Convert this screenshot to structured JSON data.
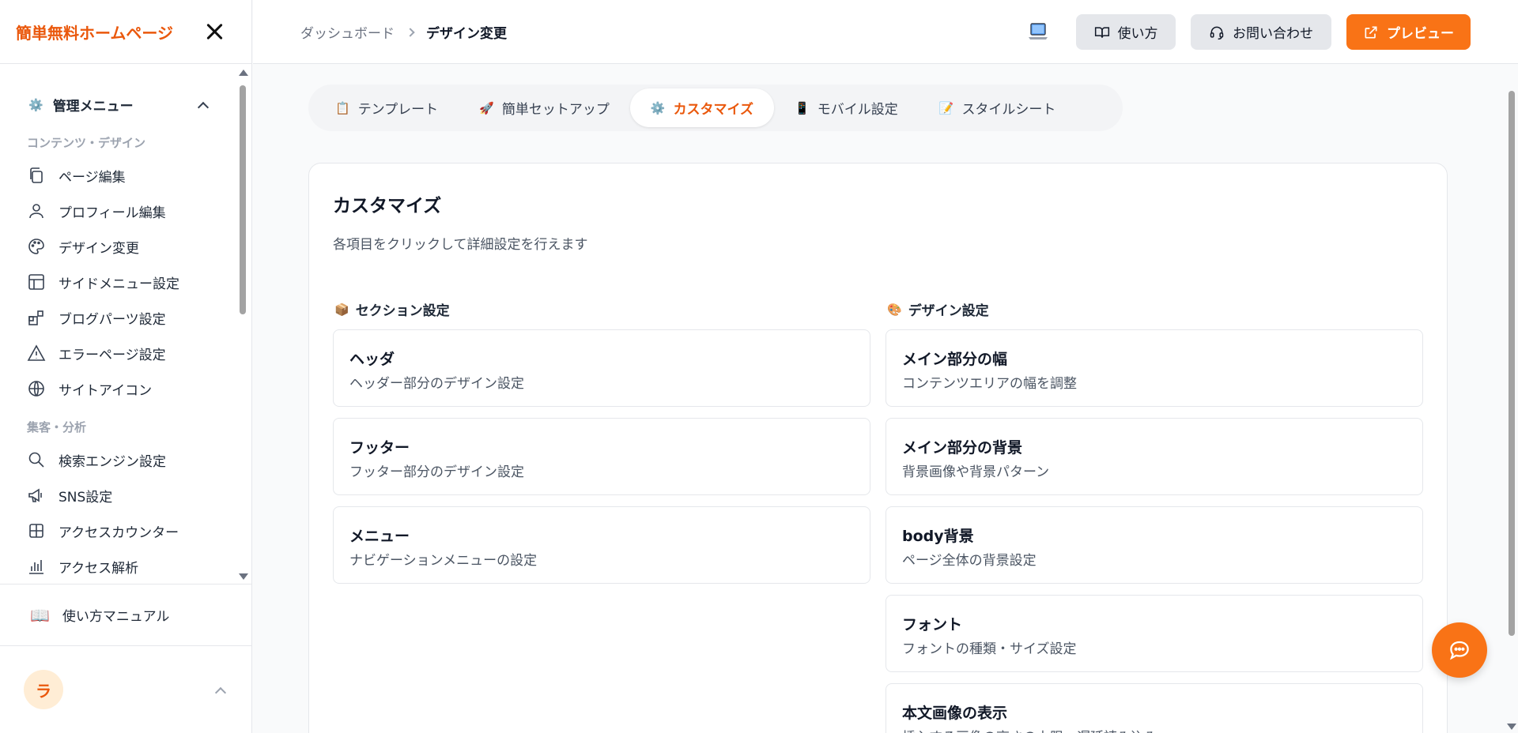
{
  "brand": {
    "title": "簡単無料ホームページ"
  },
  "sidebar": {
    "menu_title": "管理メニュー",
    "groups": [
      {
        "label": "コンテンツ・デザイン",
        "items": [
          {
            "label": "ページ編集",
            "icon": "copy-icon"
          },
          {
            "label": "プロフィール編集",
            "icon": "user-icon"
          },
          {
            "label": "デザイン変更",
            "icon": "palette-icon"
          },
          {
            "label": "サイドメニュー設定",
            "icon": "layout-icon"
          },
          {
            "label": "ブログパーツ設定",
            "icon": "blocks-icon"
          },
          {
            "label": "エラーページ設定",
            "icon": "warning-icon"
          },
          {
            "label": "サイトアイコン",
            "icon": "globe-icon"
          }
        ]
      },
      {
        "label": "集客・分析",
        "items": [
          {
            "label": "検索エンジン設定",
            "icon": "search-icon"
          },
          {
            "label": "SNS設定",
            "icon": "megaphone-icon"
          },
          {
            "label": "アクセスカウンター",
            "icon": "grid-icon"
          },
          {
            "label": "アクセス解析",
            "icon": "bar-chart-icon"
          }
        ]
      }
    ],
    "manual_label": "使い方マニュアル",
    "avatar_initial": "ラ"
  },
  "header": {
    "breadcrumb": [
      "ダッシュボード",
      "デザイン変更"
    ],
    "howto_label": "使い方",
    "contact_label": "お問い合わせ",
    "preview_label": "プレビュー"
  },
  "tabs": [
    {
      "label": "テンプレート",
      "emoji": "📋",
      "active": false
    },
    {
      "label": "簡単セットアップ",
      "emoji": "🚀",
      "active": false
    },
    {
      "label": "カスタマイズ",
      "emoji": "⚙️",
      "active": true
    },
    {
      "label": "モバイル設定",
      "emoji": "📱",
      "active": false
    },
    {
      "label": "スタイルシート",
      "emoji": "📝",
      "active": false
    }
  ],
  "main": {
    "title": "カスタマイズ",
    "description": "各項目をクリックして詳細設定を行えます",
    "section_settings": {
      "heading": "セクション設定",
      "emoji": "📦",
      "items": [
        {
          "title": "ヘッダ",
          "sub": "ヘッダー部分のデザイン設定"
        },
        {
          "title": "フッター",
          "sub": "フッター部分のデザイン設定"
        },
        {
          "title": "メニュー",
          "sub": "ナビゲーションメニューの設定"
        }
      ]
    },
    "design_settings": {
      "heading": "デザイン設定",
      "emoji": "🎨",
      "items": [
        {
          "title": "メイン部分の幅",
          "sub": "コンテンツエリアの幅を調整"
        },
        {
          "title": "メイン部分の背景",
          "sub": "背景画像や背景パターン"
        },
        {
          "title": "body背景",
          "sub": "ページ全体の背景設定"
        },
        {
          "title": "フォント",
          "sub": "フォントの種類・サイズ設定"
        },
        {
          "title": "本文画像の表示",
          "sub": "挿入する画像の高さの上限・遅延読み込み"
        }
      ]
    }
  },
  "colors": {
    "accent": "#f97316",
    "brand_text": "#ea580c"
  }
}
